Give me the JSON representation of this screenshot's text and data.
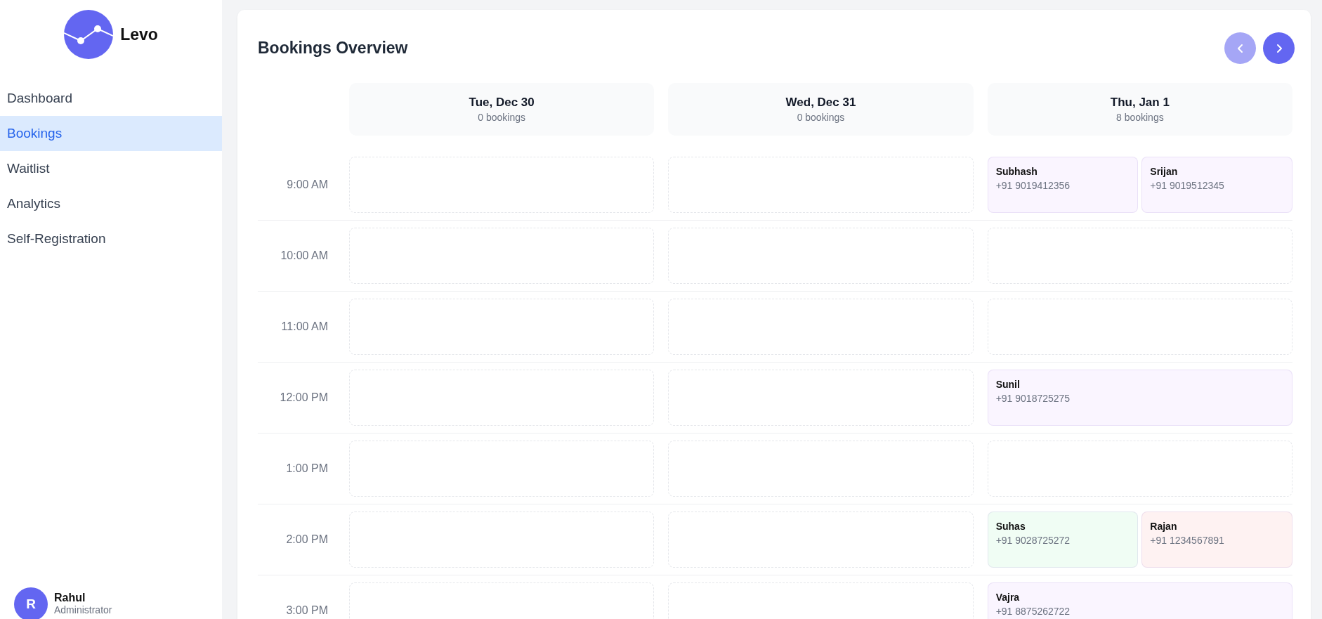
{
  "sidebar": {
    "brand": "Levo",
    "items": [
      {
        "label": "Dashboard",
        "selected": false
      },
      {
        "label": "Bookings",
        "selected": true
      },
      {
        "label": "Waitlist",
        "selected": false
      },
      {
        "label": "Analytics",
        "selected": false
      },
      {
        "label": "Self-Registration",
        "selected": false
      }
    ],
    "user": {
      "initial": "R",
      "name": "Rahul",
      "role": "Administrator"
    }
  },
  "main": {
    "title": "Bookings Overview",
    "nav": {
      "prev_disabled": true,
      "next_disabled": false
    },
    "days": [
      {
        "date": "Tue, Dec 30",
        "count": "0 bookings"
      },
      {
        "date": "Wed, Dec 31",
        "count": "0 bookings"
      },
      {
        "date": "Thu, Jan 1",
        "count": "8 bookings"
      }
    ],
    "rows": [
      {
        "time": "9:00 AM",
        "cells": [
          {
            "kind": "empty"
          },
          {
            "kind": "empty"
          },
          {
            "kind": "booked",
            "bookings": [
              {
                "name": "Subhash",
                "phone": "+91 9019412356",
                "color": "#faf5ff"
              },
              {
                "name": "Srijan",
                "phone": "+91 9019512345",
                "color": "#faf5ff"
              }
            ]
          }
        ]
      },
      {
        "time": "10:00 AM",
        "cells": [
          {
            "kind": "empty"
          },
          {
            "kind": "empty"
          },
          {
            "kind": "empty"
          }
        ]
      },
      {
        "time": "11:00 AM",
        "cells": [
          {
            "kind": "empty"
          },
          {
            "kind": "empty"
          },
          {
            "kind": "empty"
          }
        ]
      },
      {
        "time": "12:00 PM",
        "cells": [
          {
            "kind": "empty"
          },
          {
            "kind": "empty"
          },
          {
            "kind": "booked",
            "bookings": [
              {
                "name": "Sunil",
                "phone": "+91 9018725275",
                "color": "#faf5ff"
              }
            ]
          }
        ]
      },
      {
        "time": "1:00 PM",
        "cells": [
          {
            "kind": "empty"
          },
          {
            "kind": "empty"
          },
          {
            "kind": "empty"
          }
        ]
      },
      {
        "time": "2:00 PM",
        "cells": [
          {
            "kind": "empty"
          },
          {
            "kind": "empty"
          },
          {
            "kind": "booked",
            "bookings": [
              {
                "name": "Suhas",
                "phone": "+91 9028725272",
                "color": "#f0fdf4"
              },
              {
                "name": "Rajan",
                "phone": "+91 1234567891",
                "color": "#fef2f2"
              }
            ]
          }
        ]
      },
      {
        "time": "3:00 PM",
        "cells": [
          {
            "kind": "empty"
          },
          {
            "kind": "empty"
          },
          {
            "kind": "booked",
            "bookings": [
              {
                "name": "Vajra",
                "phone": "+91 8875262722",
                "color": "#faf5ff"
              }
            ]
          }
        ]
      }
    ]
  }
}
